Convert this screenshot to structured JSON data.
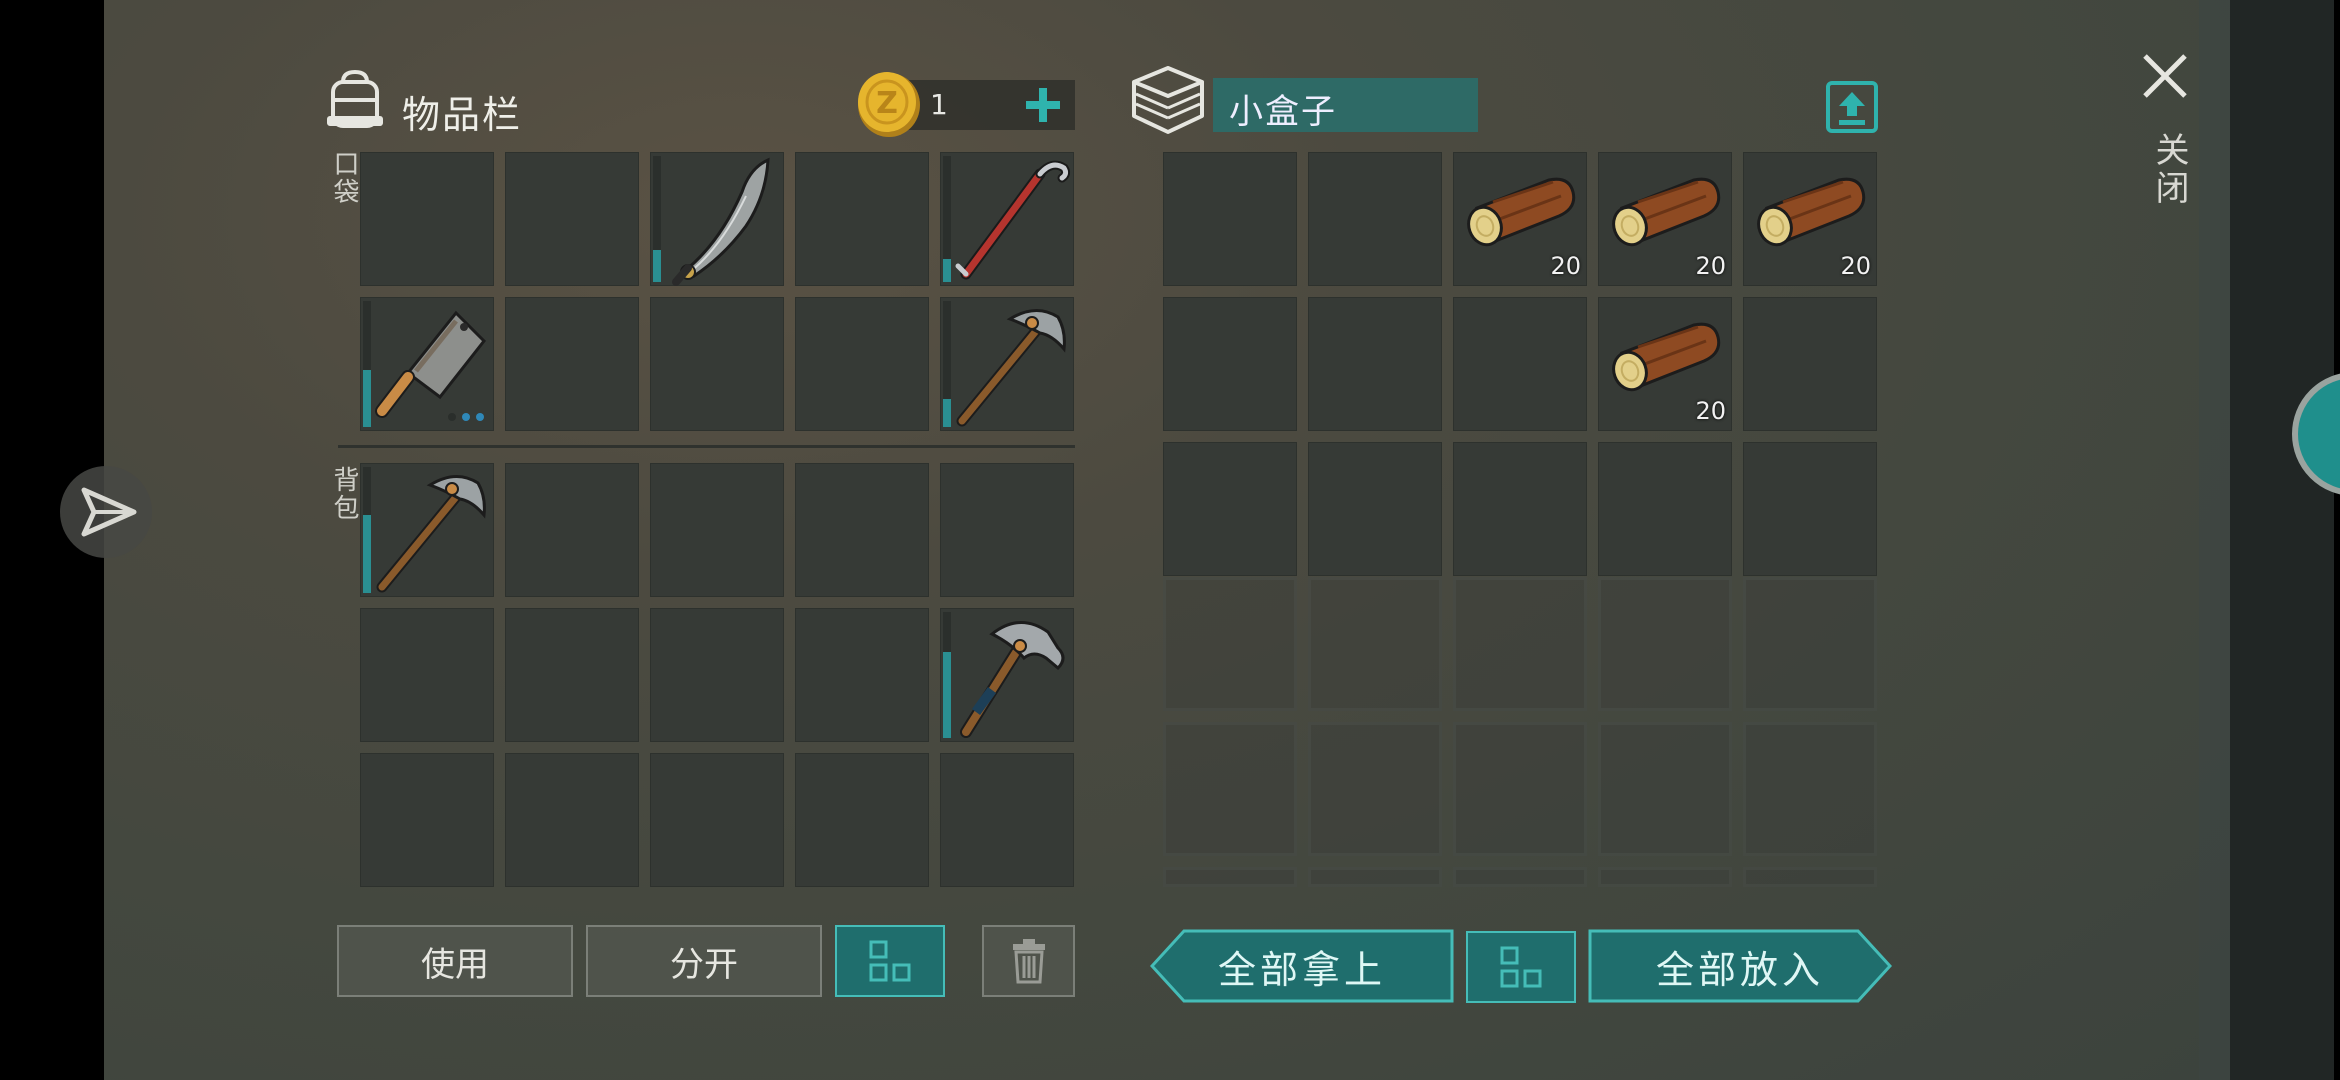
{
  "inventory": {
    "title": "物品栏",
    "coin_count": "1",
    "pocket_label": "口袋",
    "backpack_label": "背包",
    "pocket": [
      {
        "item": "",
        "count": "",
        "durability": null
      },
      {
        "item": "",
        "count": "",
        "durability": null
      },
      {
        "item": "machete",
        "count": "",
        "durability": 0.25
      },
      {
        "item": "",
        "count": "",
        "durability": null
      },
      {
        "item": "crowbar",
        "count": "",
        "durability": 0.18
      },
      {
        "item": "cleaver",
        "count": "",
        "durability": 0.45
      },
      {
        "item": "",
        "count": "",
        "durability": null
      },
      {
        "item": "",
        "count": "",
        "durability": null
      },
      {
        "item": "",
        "count": "",
        "durability": null
      },
      {
        "item": "stone-pickaxe",
        "count": "",
        "durability": 0.22
      }
    ],
    "backpack": [
      {
        "item": "stone-pickaxe",
        "count": "",
        "durability": 0.62
      },
      {
        "item": "",
        "count": "",
        "durability": null
      },
      {
        "item": "",
        "count": "",
        "durability": null
      },
      {
        "item": "",
        "count": "",
        "durability": null
      },
      {
        "item": "",
        "count": "",
        "durability": null
      },
      {
        "item": "",
        "count": "",
        "durability": null
      },
      {
        "item": "",
        "count": "",
        "durability": null
      },
      {
        "item": "",
        "count": "",
        "durability": null
      },
      {
        "item": "",
        "count": "",
        "durability": null
      },
      {
        "item": "iron-hammer",
        "count": "",
        "durability": 0.68
      },
      {
        "item": "",
        "count": "",
        "durability": null
      },
      {
        "item": "",
        "count": "",
        "durability": null
      },
      {
        "item": "",
        "count": "",
        "durability": null
      },
      {
        "item": "",
        "count": "",
        "durability": null
      },
      {
        "item": "",
        "count": "",
        "durability": null
      }
    ],
    "buttons": {
      "use": "使用",
      "split": "分开"
    }
  },
  "container": {
    "name": "小盒子",
    "slots": [
      {
        "item": "",
        "count": ""
      },
      {
        "item": "",
        "count": ""
      },
      {
        "item": "wood-log",
        "count": "20"
      },
      {
        "item": "wood-log",
        "count": "20"
      },
      {
        "item": "wood-log",
        "count": "20"
      },
      {
        "item": "",
        "count": ""
      },
      {
        "item": "",
        "count": ""
      },
      {
        "item": "",
        "count": ""
      },
      {
        "item": "wood-log",
        "count": "20"
      },
      {
        "item": "",
        "count": ""
      },
      {
        "item": "",
        "count": ""
      },
      {
        "item": "",
        "count": ""
      },
      {
        "item": "",
        "count": ""
      },
      {
        "item": "",
        "count": ""
      },
      {
        "item": "",
        "count": ""
      }
    ],
    "buttons": {
      "take_all": "全部拿上",
      "put_all": "全部放入"
    }
  },
  "close_label": "关闭",
  "colors": {
    "accent": "#45bdb8",
    "slot": "#363a36",
    "durability": "#2a8f92",
    "coin": "#e6b52d"
  }
}
